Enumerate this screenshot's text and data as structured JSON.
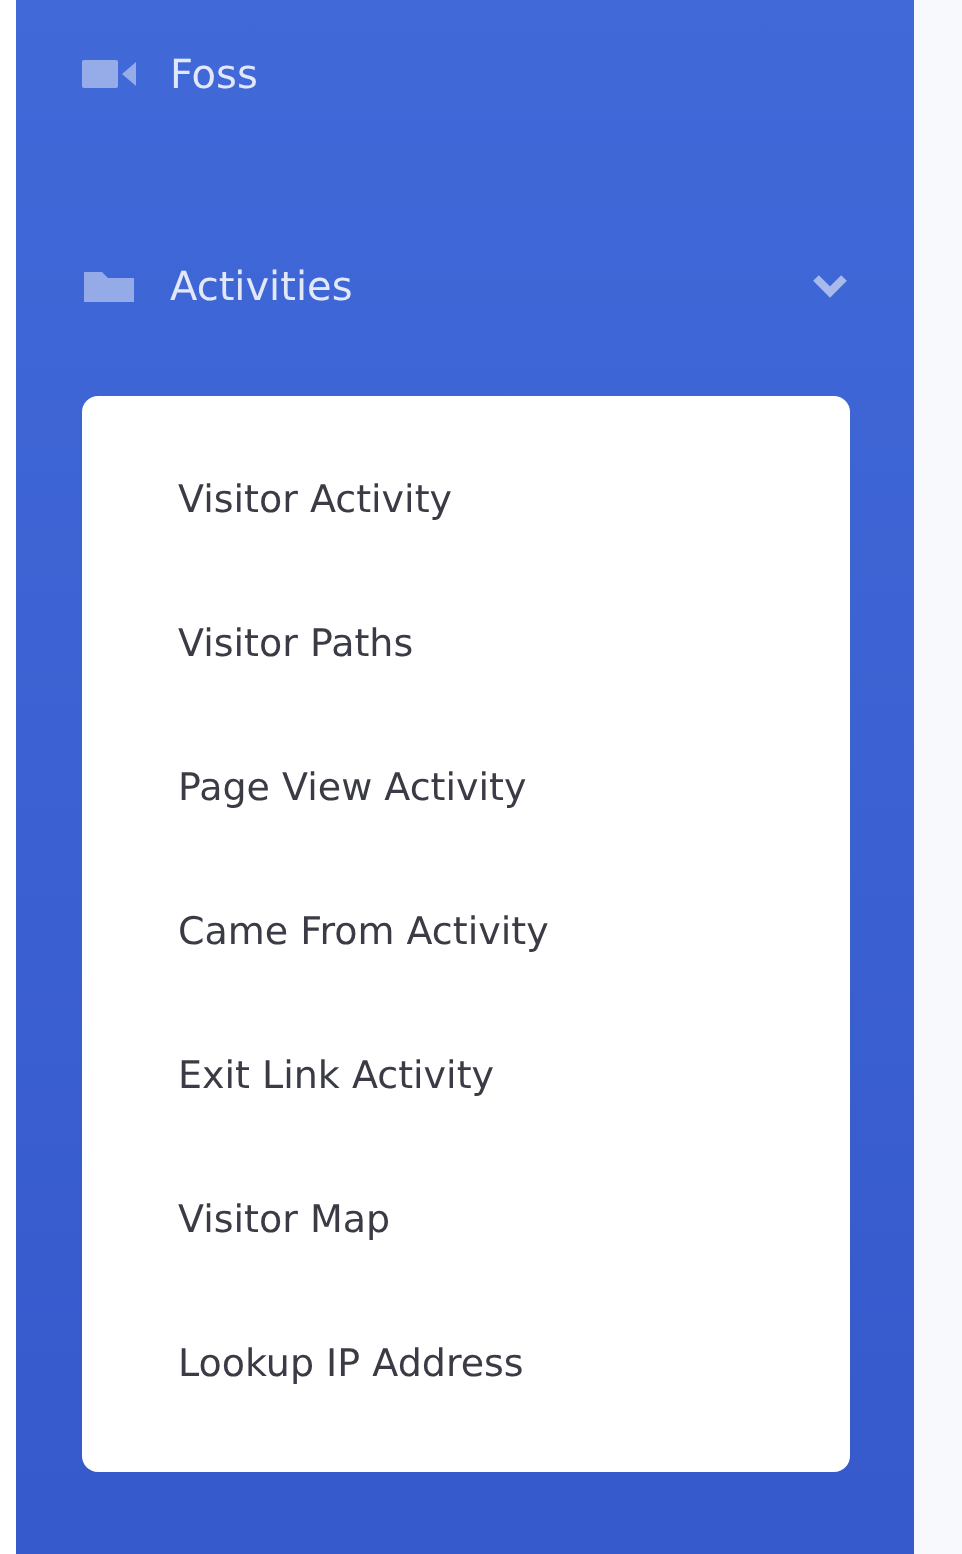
{
  "sidebar": {
    "items": [
      {
        "label": "Foss",
        "kind": "video"
      },
      {
        "label": "Activities",
        "kind": "folder",
        "expanded": true,
        "children": [
          {
            "label": "Visitor Activity"
          },
          {
            "label": "Visitor Paths"
          },
          {
            "label": "Page View Activity"
          },
          {
            "label": "Came From Activity"
          },
          {
            "label": "Exit Link Activity"
          },
          {
            "label": "Visitor Map"
          },
          {
            "label": "Lookup IP Address"
          }
        ]
      }
    ]
  }
}
